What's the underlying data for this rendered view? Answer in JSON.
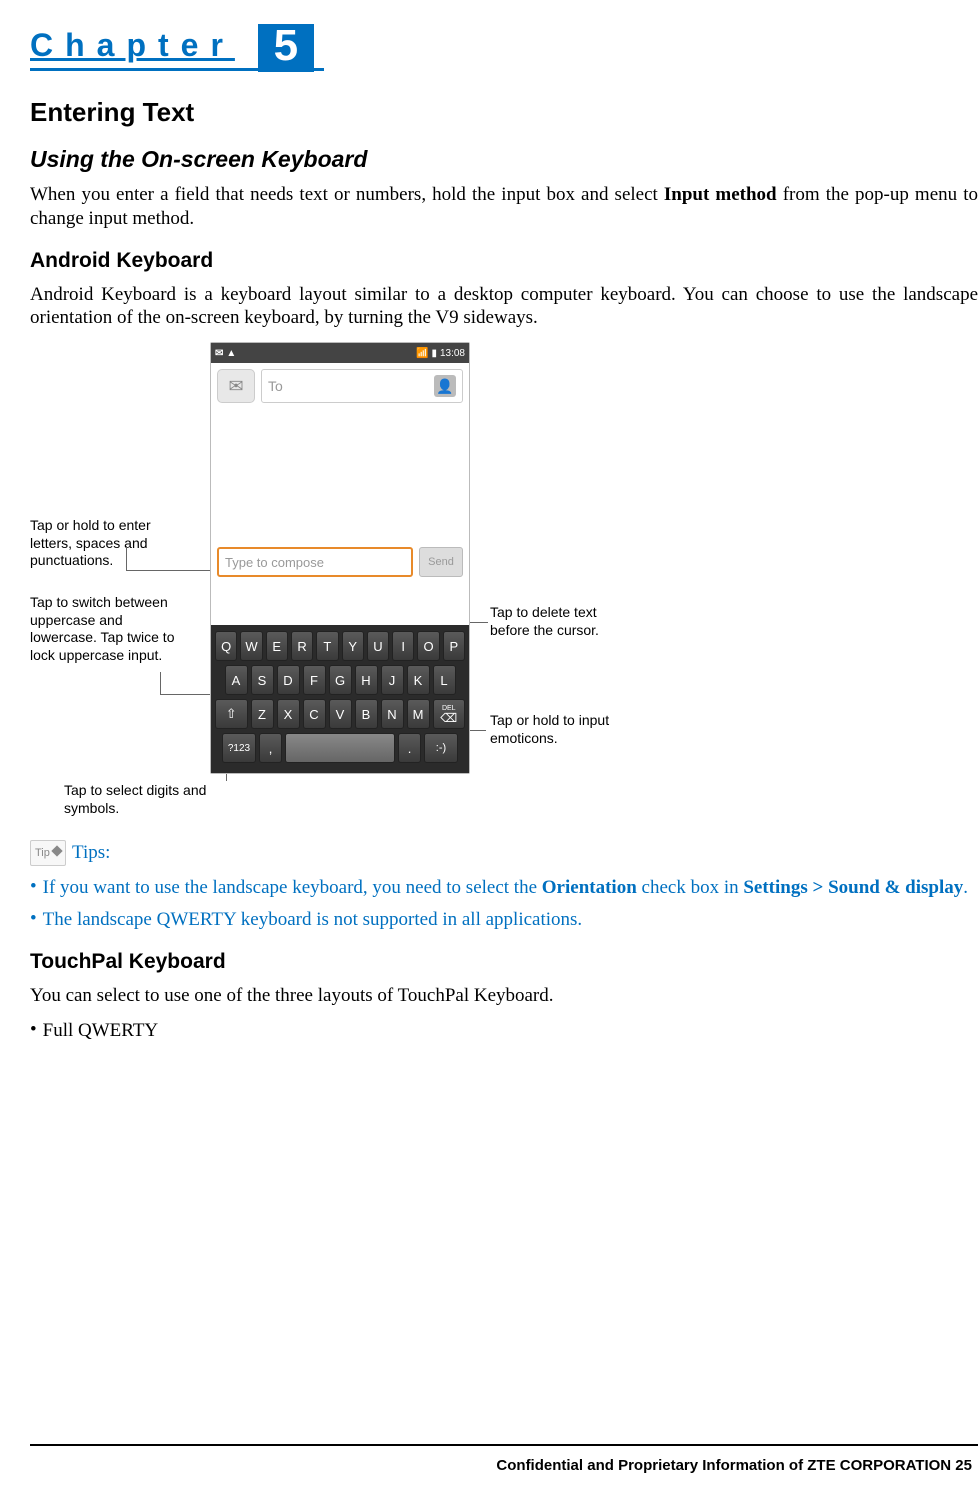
{
  "chapter": {
    "label": "Chapter",
    "number": "5"
  },
  "h1": "Entering Text",
  "h2_keyboard": "Using the On-screen Keyboard",
  "p_intro_a": "When you enter a field that needs text or numbers, hold the input box and select ",
  "p_intro_bold": "Input method",
  "p_intro_b": " from the pop-up menu to change input method.",
  "h3_android": "Android Keyboard",
  "p_android": "Android Keyboard is a keyboard layout similar to a desktop computer keyboard. You can choose to use the landscape orientation of the on-screen keyboard, by turning the V9 sideways.",
  "figure": {
    "statusbar_time": "13:08",
    "to_placeholder": "To",
    "compose_placeholder": "Type to compose",
    "send_label": "Send",
    "rows": {
      "r1": [
        "Q",
        "W",
        "E",
        "R",
        "T",
        "Y",
        "U",
        "I",
        "O",
        "P"
      ],
      "r2": [
        "A",
        "S",
        "D",
        "F",
        "G",
        "H",
        "J",
        "K",
        "L"
      ],
      "r3_shift": "⇧",
      "r3": [
        "Z",
        "X",
        "C",
        "V",
        "B",
        "N",
        "M"
      ],
      "r3_del_top": "DEL",
      "r3_del_glyph": "⌫",
      "r4_sym": "?123",
      "r4_comma": ",",
      "r4_space": " ",
      "r4_dot": ".",
      "r4_smile": ":-)"
    },
    "callouts": {
      "c1": "Tap or hold to enter letters, spaces and punctuations.",
      "c2": "Tap to switch between uppercase and lowercase. Tap twice to lock uppercase input.",
      "c3": "Tap to select digits and symbols.",
      "c4": "Tap to delete text before the cursor.",
      "c5": "Tap or hold to input emoticons."
    }
  },
  "tips_label": "Tips:",
  "tip1_a": "If you want to use the landscape keyboard, you need to select the ",
  "tip1_b": "Orientation",
  "tip1_c": " check box in ",
  "tip1_d": "Settings > Sound & display",
  "tip1_e": ".",
  "tip2": "The landscape QWERTY keyboard is not supported in all applications.",
  "h3_touchpal": "TouchPal Keyboard",
  "p_touchpal": "You can select to use one of the three layouts of TouchPal Keyboard.",
  "bullet_full": "Full QWERTY",
  "footer": "Confidential and Proprietary Information of ZTE CORPORATION 25"
}
